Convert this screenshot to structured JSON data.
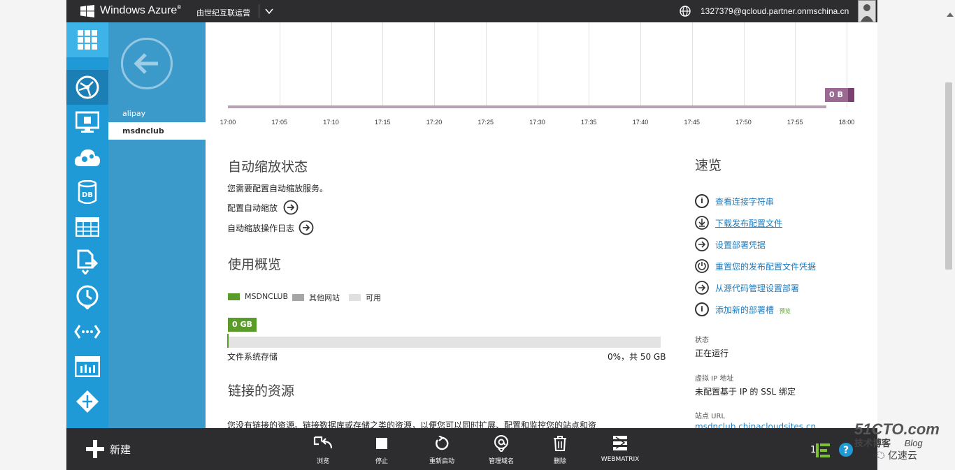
{
  "header": {
    "brand": "Windows Azure",
    "brand_mark": "®",
    "operator": "由世纪互联运营",
    "account": "1327379@qcloud.partner.onmschina.cn"
  },
  "subnav": {
    "items": [
      {
        "label": "alipay"
      },
      {
        "label": "msdnclub"
      }
    ]
  },
  "chart_data": {
    "type": "line",
    "categories": [
      "17:00",
      "17:05",
      "17:10",
      "17:15",
      "17:20",
      "17:25",
      "17:30",
      "17:35",
      "17:40",
      "17:45",
      "17:50",
      "17:55",
      "18:00"
    ],
    "values": [
      0,
      0,
      0,
      0,
      0,
      0,
      0,
      0,
      0,
      0,
      0,
      0,
      0
    ],
    "current_label": "0 B",
    "ylim": [
      0,
      1
    ]
  },
  "autoscale": {
    "title": "自动缩放状态",
    "message": "您需要配置自动缩放服务。",
    "configure": "配置自动缩放",
    "log": "自动缩放操作日志"
  },
  "usage": {
    "title": "使用概览",
    "legend": [
      "MSDNCLUB",
      "其他网站",
      "可用"
    ],
    "legend_colors": [
      "#5a9c2a",
      "#a6a6a6",
      "#e0e0e0"
    ],
    "badge": "0 GB",
    "fill_fraction": 0.0,
    "storage_label": "文件系统存储",
    "storage_value": "0%，共 50 GB"
  },
  "linked": {
    "title": "链接的资源",
    "text": "您没有链接的资源。链接数据库或存储之类的资源，以便您可以同时扩展、配置和监控您的站点和资"
  },
  "quickglance": {
    "title": "速览",
    "links": [
      {
        "label": "查看连接字符串",
        "icon": "info-icon"
      },
      {
        "label": "下载发布配置文件",
        "icon": "download-icon"
      },
      {
        "label": "设置部署凭据",
        "icon": "arrow-right-icon"
      },
      {
        "label": "重置您的发布配置文件凭据",
        "icon": "power-icon"
      },
      {
        "label": "从源代码管理设置部署",
        "icon": "arrow-right-icon"
      },
      {
        "label": "添加新的部署槽",
        "icon": "info-icon"
      }
    ],
    "preview_tag": "预览",
    "status_label": "状态",
    "status_value": "正在运行",
    "vip_label": "虚拟 IP 地址",
    "vip_value": "未配置基于 IP 的 SSL 绑定",
    "url_label": "站点 URL",
    "url_value": "msdnclub.chinacloudsites.cn"
  },
  "commandbar": {
    "new": "新建",
    "commands": [
      "浏览",
      "停止",
      "重新启动",
      "管理域名",
      "删除",
      "WEBMATRIX"
    ],
    "count": "1"
  },
  "watermark": {
    "site": "51CTO.com",
    "tag1": "技术博客",
    "tag2": "Blog",
    "brand": "亿速云"
  }
}
